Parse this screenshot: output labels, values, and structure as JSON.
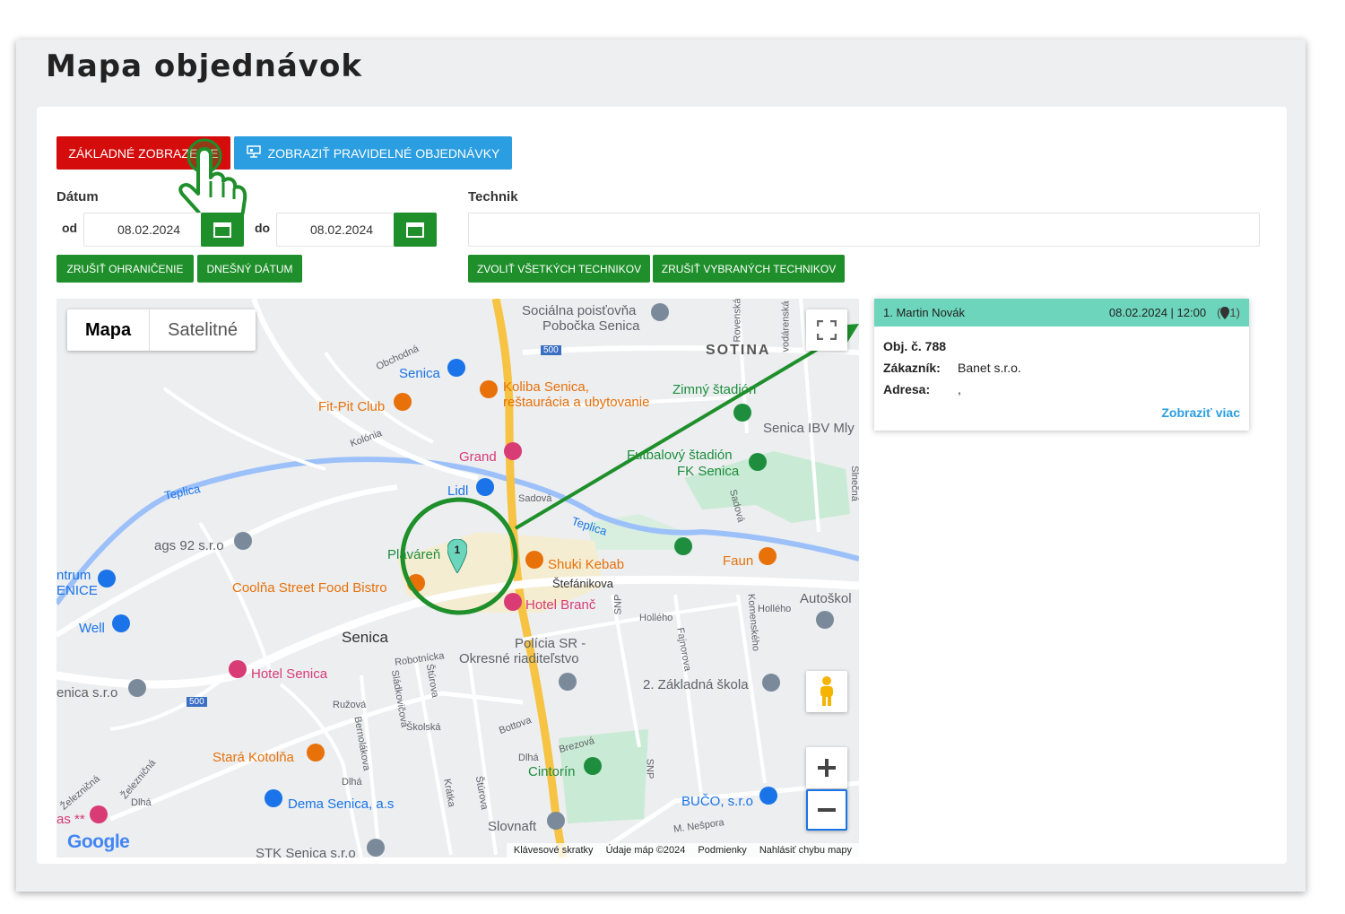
{
  "page": {
    "title": "Mapa objednávok"
  },
  "toolbar": {
    "basic_view": "ZÁKLADNÉ ZOBRAZENIE",
    "regular_orders": "ZOBRAZIŤ PRAVIDELNÉ OBJEDNÁVKY"
  },
  "date": {
    "label": "Dátum",
    "from_label": "od",
    "from_value": "08.02.2024",
    "to_label": "do",
    "to_value": "08.02.2024",
    "clear": "ZRUŠIŤ OHRANIČENIE",
    "today": "DNEŠNÝ DÁTUM"
  },
  "technician": {
    "label": "Technik",
    "value": "",
    "select_all": "ZVOLIŤ VŠETKÝCH TECHNIKOV",
    "clear_selected": "ZRUŠIŤ VYBRANÝCH TECHNIKOV"
  },
  "map": {
    "type_map": "Mapa",
    "type_satellite": "Satelitné",
    "cluster_count": "1",
    "labels": {
      "sotina": "SOTINA",
      "socialna": "Sociálna poisťovňa",
      "socialna2": "Pobočka Senica",
      "senica_shop": "Senica",
      "koliba": "Koliba Senica,",
      "koliba2": "reštaurácia a ubytovanie",
      "fitpit": "Fit-Pit Club",
      "zimny": "Zimný štadión",
      "ibv": "Senica IBV Mly",
      "grand": "Grand",
      "futbal": "Futbalový štadión",
      "futbal2": "FK Senica",
      "lidl": "Lidl",
      "teplica": "Teplica",
      "teplica2": "Teplica",
      "ags": "ags 92 s.r.o",
      "plavaren": "Plaváreň",
      "shuki": "Shuki Kebab",
      "faun": "Faun",
      "centrum": "ntrum",
      "centrum2": "ENICE",
      "coolna": "Coolňa Street Food Bistro",
      "stefanikova": "Štefánikova",
      "hotel_branc": "Hotel Branč",
      "autoskola": "Autoškol",
      "well": "Well",
      "senica_city": "Senica",
      "policia": "Polícia SR -",
      "policia2": "Okresné riaditeľstvo",
      "hotel_senica": "Hotel Senica",
      "zakladna": "2. Základná škola",
      "senica_sro": "enica s.r.o",
      "stara": "Stará Kotolňa",
      "cintorin": "Cintorín",
      "dema": "Dema Senica, a.s",
      "buco": "BUČO, s.r.o",
      "slovnaft": "Slovnaft",
      "stk": "STK Senica s.r.o",
      "as": "as **",
      "road500a": "500",
      "road500b": "500",
      "obchodna": "Obchodná",
      "kolonia": "Kolónia",
      "sadova": "Sadová",
      "sadova2": "Sadová",
      "hollého": "Hollého",
      "hollého2": "Hollého",
      "robotnicka": "Robotnícka",
      "sturova": "Štúrova",
      "sladkovicova": "Sládkovičova",
      "skolska": "Školská",
      "ruzova": "Ružová",
      "bernolakova": "Bernolákova",
      "bottova": "Bottova",
      "brezova": "Brezová",
      "dlha": "Dlhá",
      "dlha2": "Dlhá",
      "dlha3": "Dlhá",
      "kratka": "Krátka",
      "sturova2": "Štúrova",
      "fajnorova": "Fajnorova",
      "komenskeho": "Komenského",
      "snp": "SNP",
      "snp2": "SNP",
      "nespora": "M. Nešpora",
      "zeleznicna": "Železničná",
      "zeleznicna2": "Železničná",
      "rovenska": "Rovenská",
      "vodarenska": "vodárenská",
      "slnecna": "Slnečná"
    },
    "attribution": {
      "shortcuts": "Klávesové skratky",
      "data": "Údaje máp ©2024",
      "terms": "Podmienky",
      "report": "Nahlásiť chybu mapy"
    },
    "google": "Google"
  },
  "info": {
    "name": "1. Martin Novák",
    "datetime": "08.02.2024 | 12:00",
    "count": "1",
    "order_label": "Obj. č. 788",
    "customer_label": "Zákazník:",
    "customer_value": "Banet s.r.o.",
    "address_label": "Adresa:",
    "address_value": ",",
    "more": "Zobraziť viac"
  }
}
